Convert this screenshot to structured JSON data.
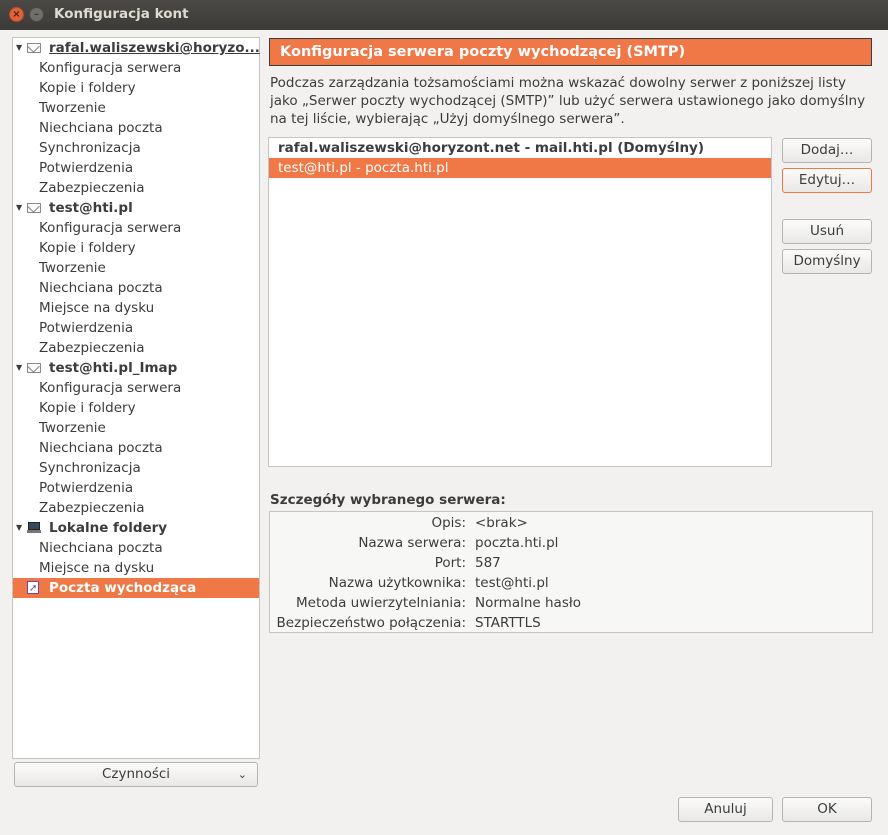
{
  "window": {
    "title": "Konfiguracja kont"
  },
  "sidebar": {
    "accounts": [
      {
        "label": "rafal.waliszewski@horyzo...",
        "icon": "envelope-icon",
        "items": [
          "Konfiguracja serwera",
          "Kopie i foldery",
          "Tworzenie",
          "Niechciana poczta",
          "Synchronizacja",
          "Potwierdzenia",
          "Zabezpieczenia"
        ]
      },
      {
        "label": "test@hti.pl",
        "icon": "envelope-icon",
        "items": [
          "Konfiguracja serwera",
          "Kopie i foldery",
          "Tworzenie",
          "Niechciana poczta",
          "Miejsce na dysku",
          "Potwierdzenia",
          "Zabezpieczenia"
        ]
      },
      {
        "label": "test@hti.pl_Imap",
        "icon": "envelope-icon",
        "items": [
          "Konfiguracja serwera",
          "Kopie i foldery",
          "Tworzenie",
          "Niechciana poczta",
          "Synchronizacja",
          "Potwierdzenia",
          "Zabezpieczenia"
        ]
      },
      {
        "label": "Lokalne foldery",
        "icon": "computer-icon",
        "items": [
          "Niechciana poczta",
          "Miejsce na dysku"
        ]
      }
    ],
    "outgoing": "Poczta wychodząca",
    "actions_label": "Czynności"
  },
  "main": {
    "header": "Konfiguracja serwera poczty wychodzącej (SMTP)",
    "description": "Podczas zarządzania tożsamościami można wskazać dowolny serwer z poniższej listy jako „Serwer poczty wychodzącej (SMTP)” lub użyć serwera ustawionego jako domyślny na tej liście, wybierając „Użyj domyślnego serwera”.",
    "servers": [
      "rafal.waliszewski@horyzont.net - mail.hti.pl (Domyślny)",
      "test@hti.pl - poczta.hti.pl"
    ],
    "buttons": {
      "add": "Dodaj…",
      "edit": "Edytuj…",
      "remove": "Usuń",
      "default": "Domyślny"
    },
    "details": {
      "title": "Szczegóły wybranego serwera:",
      "rows": [
        {
          "label": "Opis:",
          "value": "<brak>"
        },
        {
          "label": "Nazwa serwera:",
          "value": "poczta.hti.pl"
        },
        {
          "label": "Port:",
          "value": "587"
        },
        {
          "label": "Nazwa użytkownika:",
          "value": "test@hti.pl"
        },
        {
          "label": "Metoda uwierzytelniania:",
          "value": "Normalne hasło"
        },
        {
          "label": "Bezpieczeństwo połączenia:",
          "value": "STARTTLS"
        }
      ]
    }
  },
  "footer": {
    "cancel": "Anuluj",
    "ok": "OK"
  },
  "colors": {
    "accent": "#f07746",
    "titlebar": "#3c3b37"
  }
}
